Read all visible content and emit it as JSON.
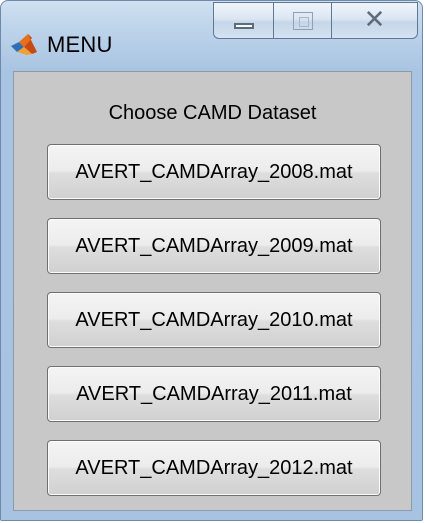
{
  "window": {
    "title": "MENU",
    "app_icon": "matlab-logo-icon",
    "caption_buttons": {
      "minimize_icon": "minimize-icon",
      "maximize_icon": "maximize-icon",
      "close_icon": "close-icon",
      "close_glyph": "✕"
    }
  },
  "main": {
    "heading": "Choose CAMD Dataset",
    "buttons": [
      {
        "label": "AVERT_CAMDArray_2008.mat"
      },
      {
        "label": "AVERT_CAMDArray_2009.mat"
      },
      {
        "label": "AVERT_CAMDArray_2010.mat"
      },
      {
        "label": "AVERT_CAMDArray_2011.mat"
      },
      {
        "label": "AVERT_CAMDArray_2012.mat"
      }
    ]
  },
  "colors": {
    "frame": "#a9c4e2",
    "client_bg": "#c8c8c8",
    "button_border": "#707070"
  }
}
